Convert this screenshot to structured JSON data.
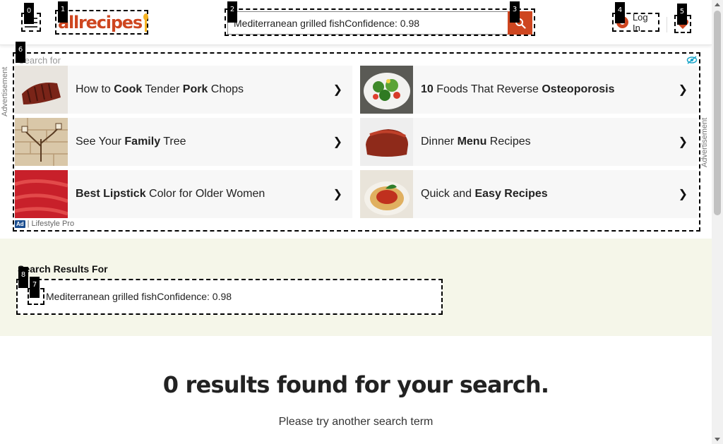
{
  "header": {
    "logo_text": "allrecipes",
    "search_value": "Mediterranean grilled fishConfidence: 0.98",
    "login_label": "Log In"
  },
  "badges": [
    "0",
    "1",
    "2",
    "3",
    "4",
    "5",
    "6",
    "7",
    "8"
  ],
  "ad": {
    "search_for": "Search for",
    "side_label": "Advertisement",
    "footer_label": "Lifestyle Pro",
    "ad_mark": "Ad",
    "arrow": "❯",
    "tiles": [
      {
        "parts": [
          "How to ",
          "Cook",
          " Tender ",
          "Pork",
          " Chops"
        ]
      },
      {
        "parts": [
          "",
          "10",
          " Foods That Reverse ",
          "Osteoporosis",
          ""
        ]
      },
      {
        "parts": [
          "See Your ",
          "Family",
          " Tree",
          "",
          ""
        ]
      },
      {
        "parts": [
          "Dinner ",
          "Menu",
          " Recipes",
          "",
          ""
        ]
      },
      {
        "parts": [
          "",
          "Best Lipstick",
          " Color for Older Women",
          "",
          ""
        ]
      },
      {
        "parts": [
          "Quick and ",
          "Easy Recipes",
          "",
          "",
          ""
        ]
      }
    ]
  },
  "results": {
    "title": "Search Results For",
    "term": "Mediterranean grilled fishConfidence: 0.98",
    "no_results": "0 results found for your search.",
    "try_another": "Please try another search term"
  },
  "colors": {
    "brand": "#ce4620",
    "band": "#f5f6e9"
  }
}
